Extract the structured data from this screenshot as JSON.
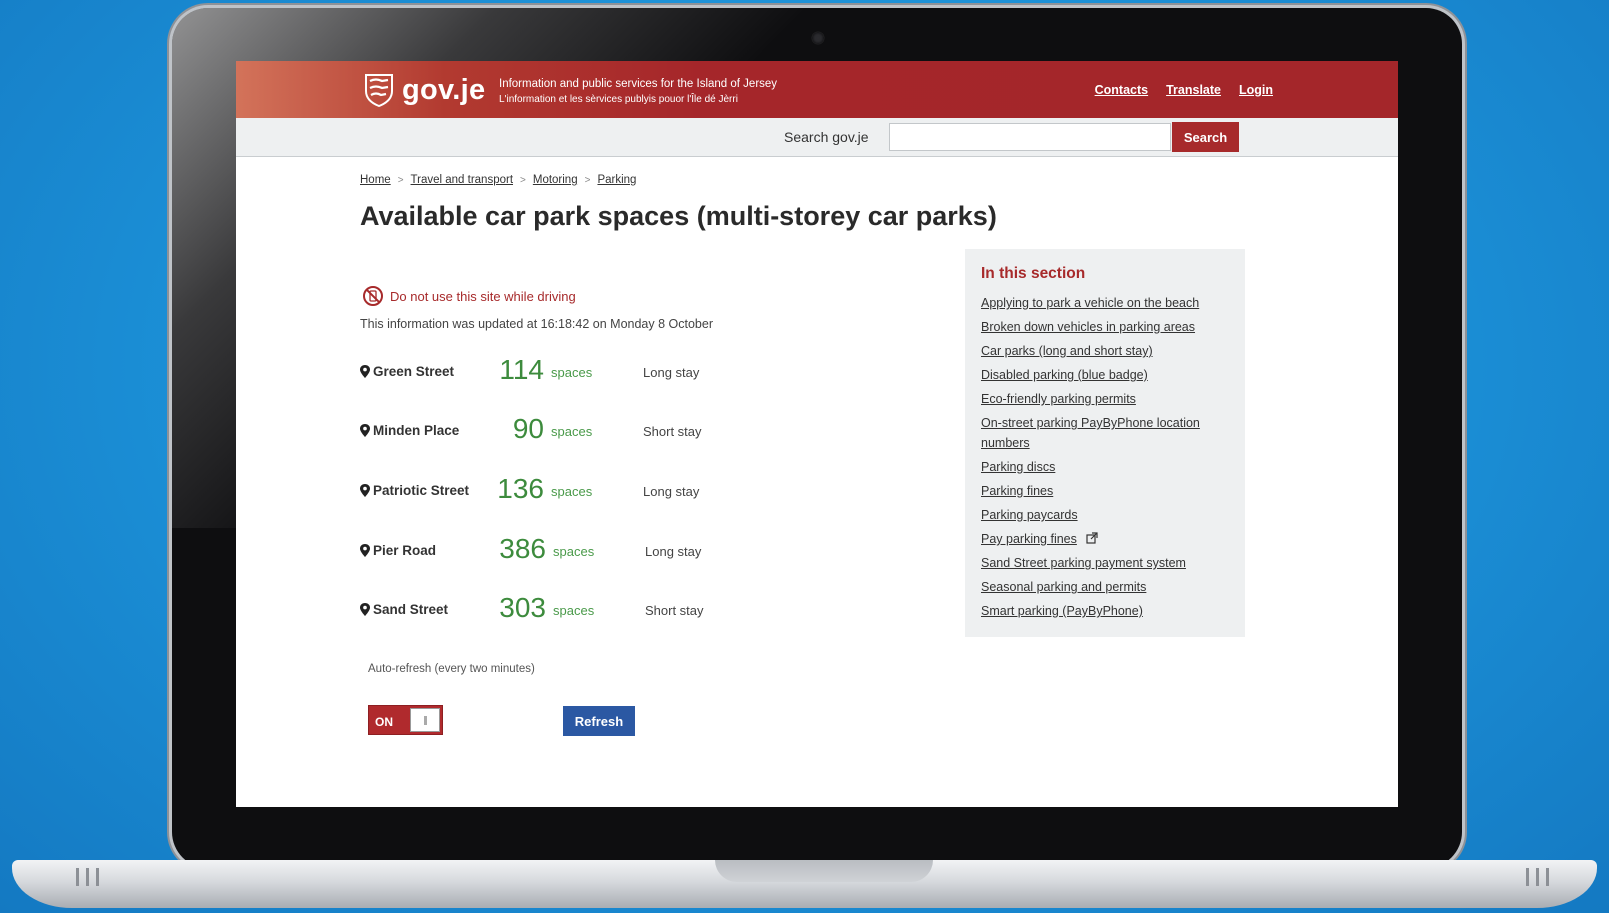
{
  "header": {
    "logo_text": "gov.je",
    "tagline_line1": "Information and public services for the Island of Jersey",
    "tagline_line2": "L'information et les sèrvices publyis pouor l'Île dé Jèrri",
    "links": [
      "Contacts",
      "Translate",
      "Login"
    ]
  },
  "search": {
    "label": "Search gov.je",
    "placeholder": "",
    "button": "Search"
  },
  "breadcrumb": [
    "Home",
    "Travel and transport",
    "Motoring",
    "Parking"
  ],
  "page_title": "Available car park spaces (multi-storey car parks)",
  "warning": "Do not use this site while driving",
  "updated_text": "This information was updated at 16:18:42 on Monday 8 October",
  "car_parks": [
    {
      "name": "Green Street",
      "spaces": "114",
      "unit": "spaces",
      "stay": "Long stay"
    },
    {
      "name": "Minden Place",
      "spaces": "90",
      "unit": "spaces",
      "stay": "Short stay"
    },
    {
      "name": "Patriotic Street",
      "spaces": "136",
      "unit": "spaces",
      "stay": "Long stay"
    },
    {
      "name": "Pier Road",
      "spaces": "386",
      "unit": "spaces",
      "stay": "Long stay"
    },
    {
      "name": "Sand Street",
      "spaces": "303",
      "unit": "spaces",
      "stay": "Short stay"
    }
  ],
  "auto_refresh": {
    "label": "Auto-refresh (every two minutes)",
    "toggle_label": "ON",
    "state": "on",
    "refresh_button": "Refresh"
  },
  "sidebar": {
    "title": "In this section",
    "links": [
      "Applying to park a vehicle on the beach",
      "Broken down vehicles in parking areas",
      "Car parks (long and short stay)",
      "Disabled parking (blue badge)",
      "Eco-friendly parking permits",
      "On-street parking PayByPhone location numbers",
      "Parking discs",
      "Parking fines",
      "Parking paycards",
      "Pay parking fines",
      "Sand Street parking payment system",
      "Seasonal parking and permits",
      "Smart parking (PayByPhone)"
    ]
  },
  "colors": {
    "brand_red": "#a72a2b",
    "spaces_green": "#3d8b3d",
    "refresh_blue": "#2b58a3",
    "background_blue": "#1b8fd6"
  },
  "icons": [
    "jersey-crest-icon",
    "no-entry-icon",
    "map-pin-icon",
    "external-link-icon"
  ]
}
